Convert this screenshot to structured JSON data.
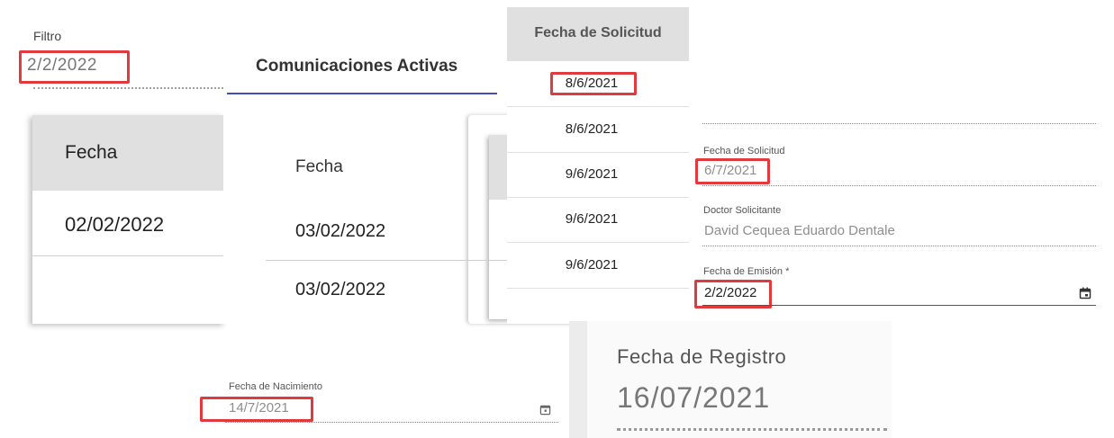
{
  "panel_filter": {
    "filter_label": "Filtro",
    "filter_value": "2/2/2022",
    "table_header": "Fecha",
    "rows": [
      "02/02/2022"
    ]
  },
  "panel_comunicaciones": {
    "tab_label": "Comunicaciones Activas",
    "table_header": "Fecha",
    "rows": [
      "03/02/2022",
      "03/02/2022"
    ]
  },
  "panel_solicitud_table": {
    "column_header": "Fecha de Solicitud",
    "rows": [
      "8/6/2021",
      "8/6/2021",
      "9/6/2021",
      "9/6/2021",
      "9/6/2021"
    ]
  },
  "panel_form": {
    "fecha_solicitud_label": "Fecha de Solicitud",
    "fecha_solicitud_value": "6/7/2021",
    "doctor_label": "Doctor Solicitante",
    "doctor_value": "David Cequea Eduardo Dentale",
    "fecha_emision_label": "Fecha de Emisión *",
    "fecha_emision_value": "2/2/2022"
  },
  "panel_nacimiento": {
    "label": "Fecha de Nacimiento",
    "value": "14/7/2021"
  },
  "panel_registro": {
    "label": "Fecha de Registro",
    "value": "16/07/2021"
  },
  "icons": {
    "calendar": "calendar-icon"
  },
  "colors": {
    "highlight": "#e0393e",
    "header_bg": "#e0e0e0",
    "tab_underline": "#3f51b5"
  }
}
